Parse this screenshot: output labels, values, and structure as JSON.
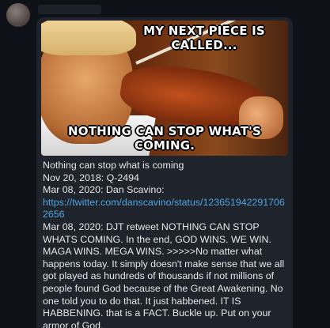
{
  "meme": {
    "caption_top": "MY NEXT PIECE IS CALLED...",
    "caption_bottom": "NOTHING CAN STOP WHAT'S COMING."
  },
  "message": {
    "line1": "Nothing can stop what is coming",
    "line2": "Nov 20, 2018: Q-2494",
    "line3_prefix": "Mar 08, 2020: Dan Scavino: ",
    "line3_link": "https://twitter.com/danscavino/status/1236519422917062656",
    "line4": "Mar 08, 2020: DJT retweet NOTHING CAN STOP WHATS COMING. In the end, GOD WINS. WE WIN. MAGA WINS. MEGA WINS. >>>>>No matter what happens today.  It simply doesn't make sense that we all got played as hundreds of thousands if not millions of people found God because of the Great Awakening. No one told you to do that. It just habbened. IT IS HABBENING. that is a FACT. Buckle up. Put on your armor of God."
  },
  "colors": {
    "background": "#0e1117",
    "bubble": "#1f242c",
    "text": "#e6e6e6",
    "link": "#4fa3e0"
  }
}
